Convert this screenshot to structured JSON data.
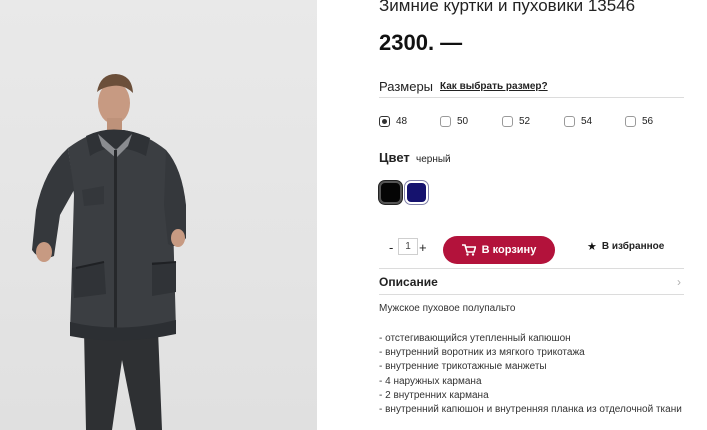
{
  "product": {
    "title": "Зимние куртки и пуховики 13546",
    "price": "2300. —",
    "photo_icon": "product-photo-man-in-black-parka"
  },
  "sizes": {
    "label": "Размеры",
    "guide_link": "Как выбрать размер?",
    "options": [
      "48",
      "50",
      "52",
      "54",
      "56"
    ],
    "selected": "48"
  },
  "color": {
    "label": "Цвет",
    "value": "черный",
    "swatches": [
      {
        "name": "black",
        "hex": "#050505"
      },
      {
        "name": "navy",
        "hex": "#15126e"
      }
    ]
  },
  "purchase": {
    "minus": "-",
    "quantity": "1",
    "plus": "+",
    "cart_label": "В корзину",
    "cart_color": "#b3123b",
    "favorite_label": "В избранное"
  },
  "description": {
    "title": "Описание",
    "intro": "Мужское пуховое полупальто",
    "items": [
      "- отстегивающийся утепленный капюшон",
      "- внутренний воротник из мягкого трикотажа",
      "- внутренние трикотажные манжеты",
      "- 4 наружных кармана",
      "- 2 внутренних кармана",
      "- внутренний капюшон и внутренняя планка из отделочной ткани"
    ]
  }
}
